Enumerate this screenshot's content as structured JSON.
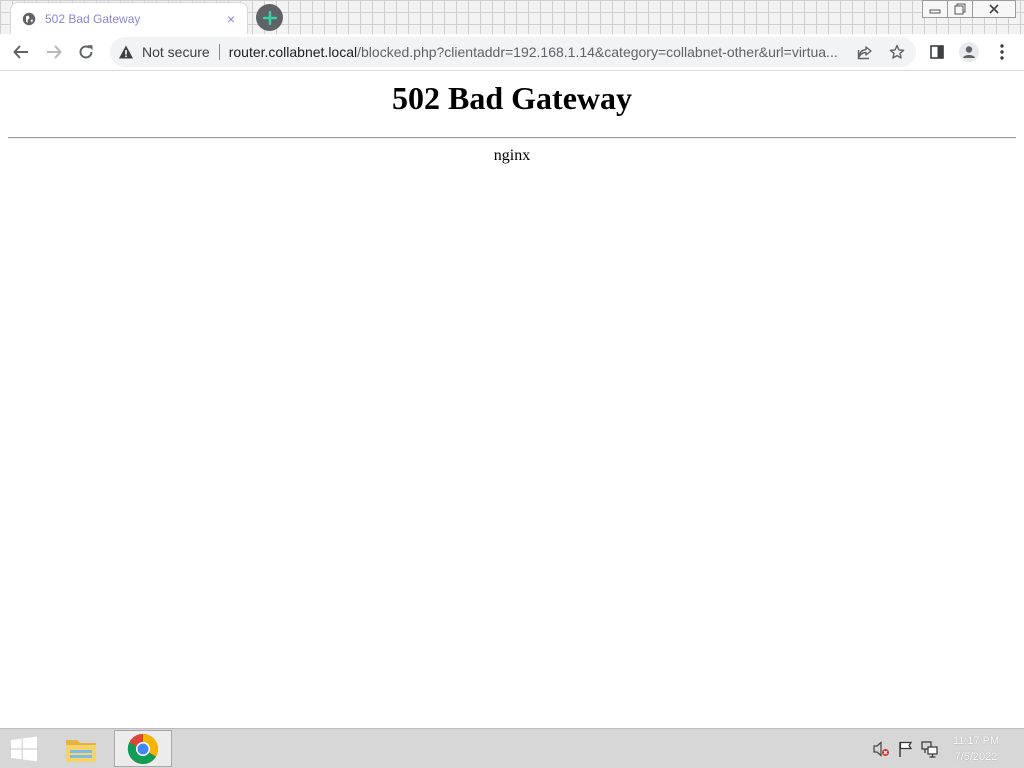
{
  "browser": {
    "tab": {
      "title": "502 Bad Gateway",
      "close_glyph": "×"
    },
    "newtab_glyph": "+",
    "address_bar": {
      "security_label": "Not secure",
      "url_host": "router.collabnet.local",
      "url_path": "/blocked.php?clientaddr=192.168.1.14&category=collabnet-other&url=virtua..."
    },
    "icons": {
      "favicon": "globe-icon",
      "back": "back-arrow-icon",
      "forward": "forward-arrow-icon",
      "reload": "reload-icon",
      "warning": "warning-triangle-icon",
      "share": "share-icon",
      "bookmark": "star-icon",
      "side_panel": "side-panel-icon",
      "profile": "profile-icon",
      "menu": "kebab-menu-icon"
    },
    "colors": {
      "tab_title": "#8a86d8",
      "newtab_button": "#5f6368",
      "newtab_plus": "#30d5a0",
      "omnibox_bg": "#f1f3f4"
    }
  },
  "page": {
    "heading": "502 Bad Gateway",
    "server": "nginx"
  },
  "taskbar": {
    "clock": {
      "time": "11:17 PM",
      "date": "7/5/2022"
    },
    "apps": [
      "file-explorer-icon",
      "chrome-icon"
    ],
    "tray": [
      "speaker-muted-icon",
      "action-center-flag-icon",
      "network-icon"
    ]
  }
}
